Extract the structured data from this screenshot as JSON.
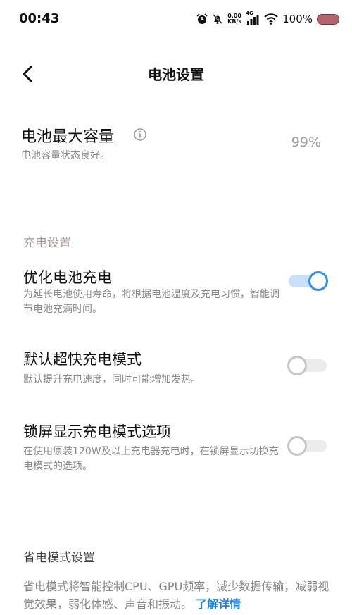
{
  "status_bar": {
    "time": "00:43",
    "net_speed_value": "0.00",
    "net_speed_unit": "KB/s",
    "network": "4G",
    "battery": "100%"
  },
  "header": {
    "title": "电池设置"
  },
  "capacity": {
    "title": "电池最大容量",
    "subtitle": "电池容量状态良好。",
    "value": "99%"
  },
  "charging": {
    "heading": "充电设置",
    "options": [
      {
        "title": "优化电池充电",
        "desc": "为延长电池使用寿命，将根据电池温度及充电习惯，智能调节电池充满时间。",
        "enabled": true
      },
      {
        "title": "默认超快充电模式",
        "desc": "默认提升充电速度，同时可能增加发热。",
        "enabled": false
      },
      {
        "title": "锁屏显示充电模式选项",
        "desc": "在使用原装120W及以上充电器充电时，在锁屏显示切换充电模式的选项。",
        "enabled": false
      }
    ]
  },
  "power_saving": {
    "heading": "省电模式设置",
    "desc": "省电模式将智能控制CPU、GPU频率，减少数据传输，减弱视觉效果，弱化体感、声音和振动。",
    "link": "了解详情"
  },
  "colors": {
    "accent": "#2f8ff0",
    "battery": "#b5636c"
  }
}
